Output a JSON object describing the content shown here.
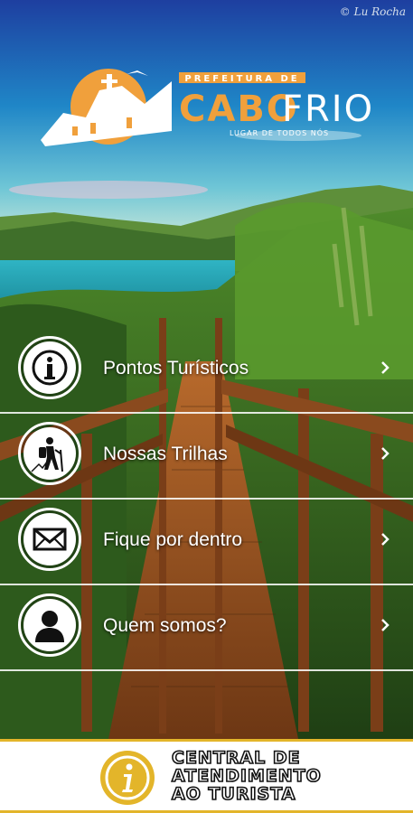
{
  "photo_credit": "© Lu Rocha",
  "logo": {
    "prefeitura": "PREFEITURA DE",
    "cabo": "CABO",
    "frio": "FRIO",
    "tagline": "LUGAR DE TODOS NÓS",
    "colors": {
      "orange": "#f0a03c",
      "white": "#ffffff"
    }
  },
  "menu": {
    "items": [
      {
        "label": "Pontos Turísticos",
        "icon": "info-icon"
      },
      {
        "label": "Nossas Trilhas",
        "icon": "hiker-icon"
      },
      {
        "label": "Fique por dentro",
        "icon": "envelope-icon"
      },
      {
        "label": "Quem somos?",
        "icon": "person-icon"
      }
    ]
  },
  "footer": {
    "line1": "CENTRAL DE",
    "line2": "ATENDIMENTO",
    "line3": "AO TURISTA",
    "icon": "info-badge-icon",
    "accent": "#e3b52a"
  }
}
